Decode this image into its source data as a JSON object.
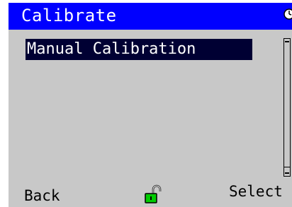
{
  "title_bar": {
    "title": "Calibrate",
    "background_color": "#0000ff",
    "status_icon": "clock-icon"
  },
  "menu": {
    "items": [
      {
        "label": "Manual Calibration",
        "selected": true
      }
    ],
    "selected_color": "#000033"
  },
  "softkeys": {
    "left_label": "Back",
    "right_label": "Select",
    "center_icon": "unlocked-padlock-icon"
  },
  "colors": {
    "content_background": "#c8c8c8",
    "lock_color": "#00cc00"
  }
}
